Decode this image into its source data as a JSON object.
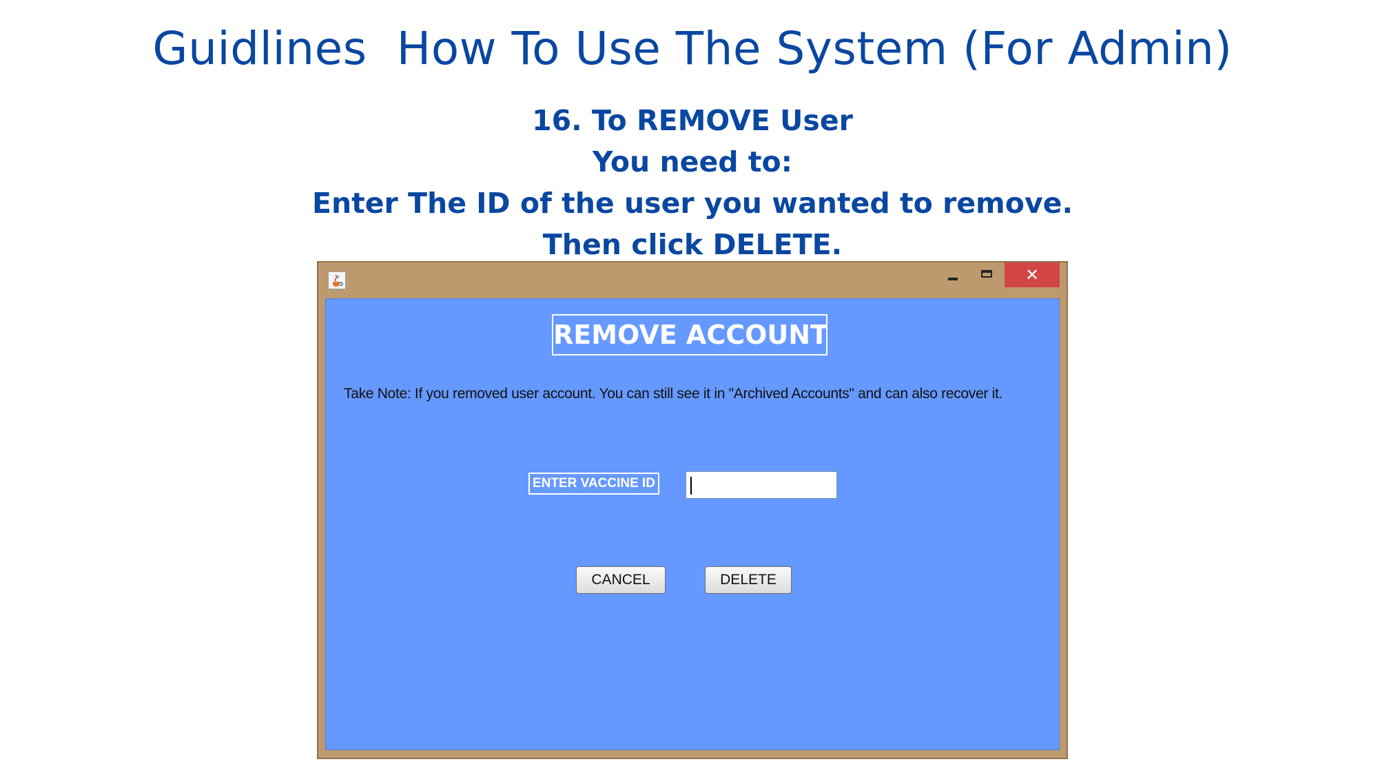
{
  "slide": {
    "title": "Guidlines  How To Use The System (For Admin)",
    "instructions": [
      "16. To REMOVE User",
      "You need to:",
      "Enter The ID of the user you wanted to remove.",
      "Then click DELETE."
    ]
  },
  "window": {
    "icon": "java-cup-icon",
    "controls": {
      "minimize_icon": "minimize-icon",
      "maximize_icon": "maximize-icon",
      "close_symbol": "✕"
    },
    "colors": {
      "frame": "#bc9a6e",
      "content": "#6699ff",
      "close": "#d24545"
    }
  },
  "form": {
    "title": "REMOVE ACCOUNT",
    "note": "Take Note: If you removed user account. You can still see it in \"Archived Accounts\" and can also recover it.",
    "id_label": "ENTER VACCINE ID",
    "id_value": "",
    "cancel_label": "CANCEL",
    "delete_label": "DELETE"
  }
}
